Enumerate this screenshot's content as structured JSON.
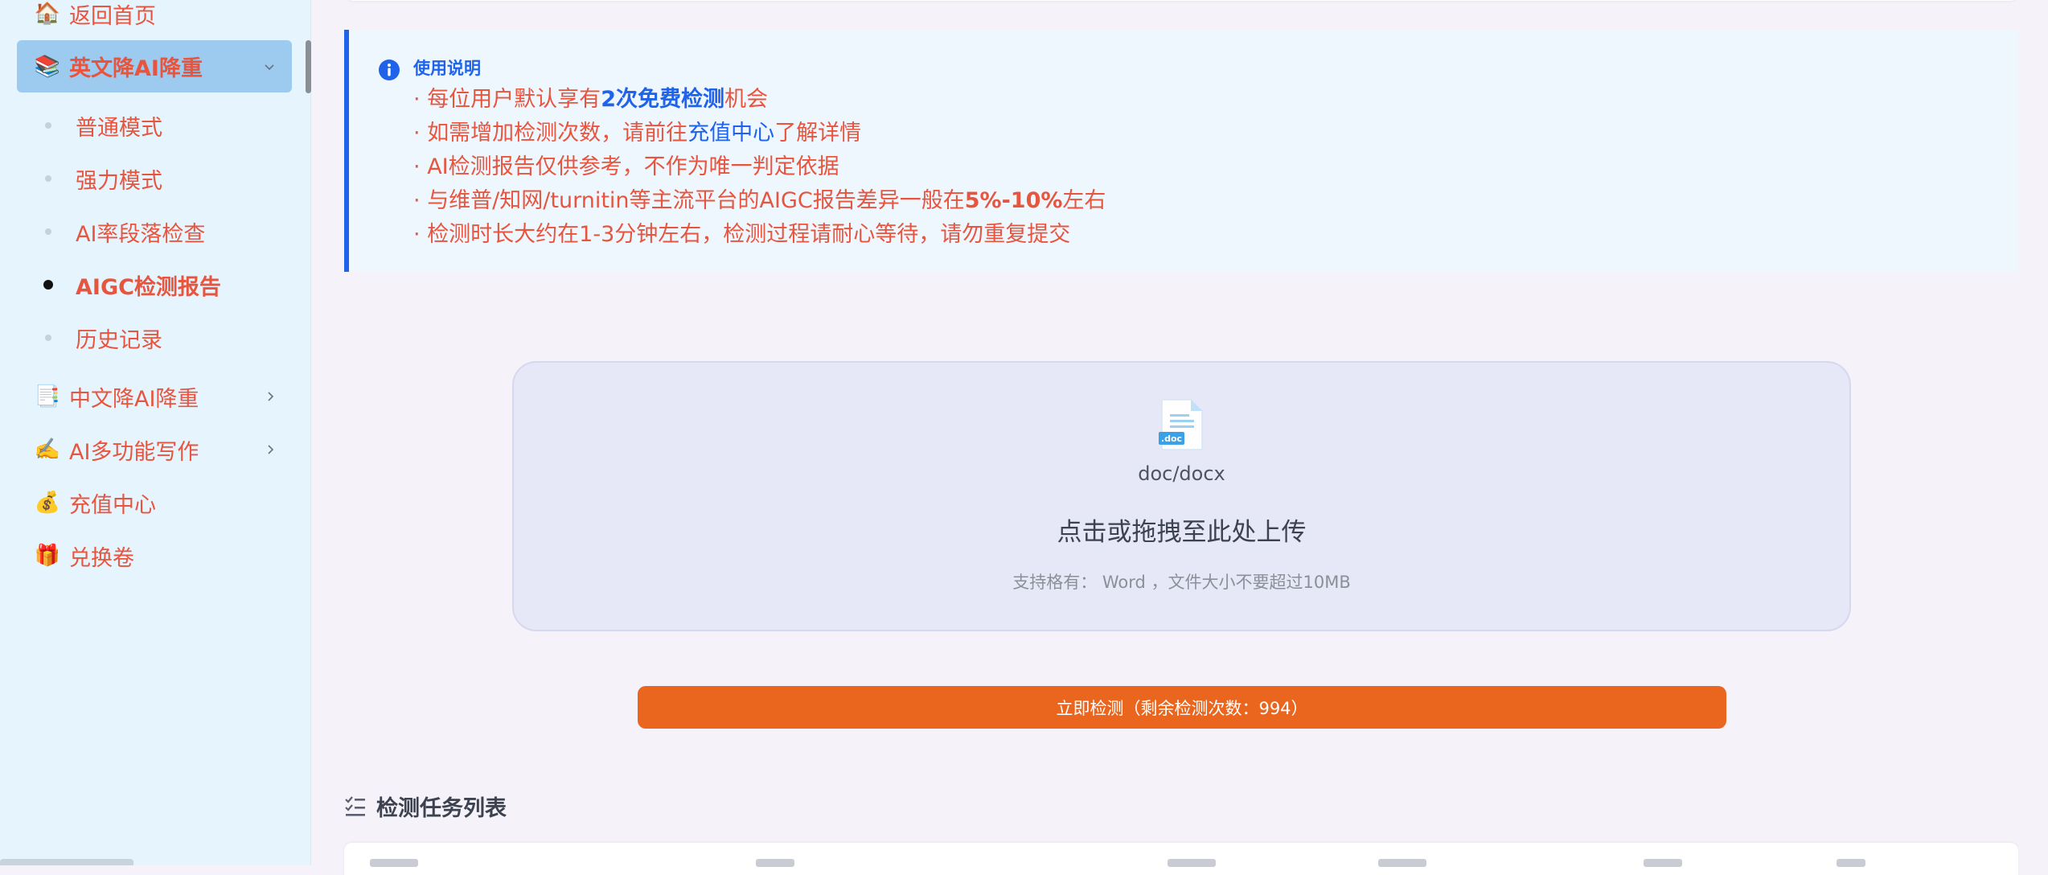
{
  "sidebar": {
    "items": [
      {
        "emoji": "🏠",
        "icon": "home-icon",
        "label": "返回首页"
      },
      {
        "emoji": "📚",
        "icon": "books-icon",
        "label": "英文降AI降重"
      },
      {
        "emoji": "📑",
        "icon": "bookmark-tabs-icon",
        "label": "中文降AI降重"
      },
      {
        "emoji": "✍️",
        "icon": "writing-hand-icon",
        "label": "AI多功能写作"
      },
      {
        "emoji": "💰",
        "icon": "money-bag-icon",
        "label": "充值中心"
      },
      {
        "emoji": "🎁",
        "icon": "gift-icon",
        "label": "兑换卷"
      }
    ],
    "sub_items": [
      {
        "label": "普通模式"
      },
      {
        "label": "强力模式"
      },
      {
        "label": "AI率段落检查"
      },
      {
        "label": "AIGC检测报告"
      },
      {
        "label": "历史记录"
      }
    ]
  },
  "notice": {
    "title": "使用说明",
    "bullet": "·",
    "line1": {
      "pre": "每位用户默认享有",
      "highlight": "2次免费检测",
      "post": "机会"
    },
    "line2": {
      "pre": "如需增加检测次数，请前往",
      "link": "充值中心",
      "post": "了解详情"
    },
    "line3": "AI检测报告仅供参考，不作为唯一判定依据",
    "line4": {
      "pre": "与维普/知网/turnitin等主流平台的AIGC报告差异一般在",
      "highlight": "5%-10%",
      "post": "左右"
    },
    "line5": "检测时长大约在1-3分钟左右，检测过程请耐心等待，请勿重复提交"
  },
  "upload": {
    "format": "doc/docx",
    "main_text": "点击或拖拽至此处上传",
    "hint": "支持格有： Word ，文件大小不要超过10MB"
  },
  "detect_button": {
    "label": "立即检测（剩余检测次数：994）"
  },
  "tasks": {
    "title": "检测任务列表"
  },
  "colors": {
    "sidebar_bg": "#e6f4fd",
    "accent_red": "#e8553f",
    "accent_blue": "#1e63e9",
    "button_orange": "#ea661e",
    "active_group_bg": "#9ccbef"
  }
}
